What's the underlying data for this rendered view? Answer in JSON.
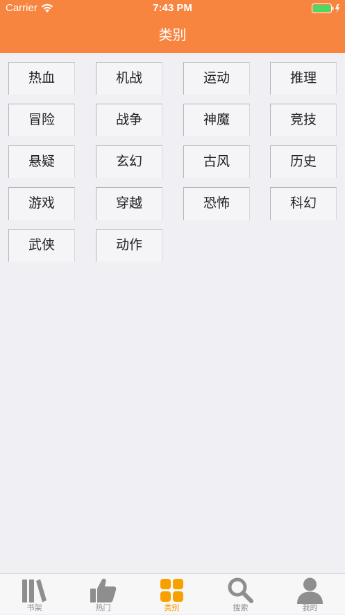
{
  "status_bar": {
    "carrier": "Carrier",
    "time": "7:43 PM"
  },
  "nav": {
    "title": "类别"
  },
  "categories": [
    "热血",
    "机战",
    "运动",
    "推理",
    "冒险",
    "战争",
    "神魔",
    "竞技",
    "悬疑",
    "玄幻",
    "古风",
    "历史",
    "游戏",
    "穿越",
    "恐怖",
    "科幻",
    "武侠",
    "动作"
  ],
  "tabbar": {
    "items": [
      {
        "label": "书架",
        "icon": "bookshelf-icon",
        "active": false
      },
      {
        "label": "热门",
        "icon": "thumbs-up-icon",
        "active": false
      },
      {
        "label": "类别",
        "icon": "category-grid-icon",
        "active": true
      },
      {
        "label": "搜索",
        "icon": "search-icon",
        "active": false
      },
      {
        "label": "我的",
        "icon": "person-icon",
        "active": false
      }
    ]
  },
  "colors": {
    "header": "#F8853F",
    "background": "#EFEFF4",
    "tab_active": "#F8A000",
    "tab_inactive": "#8E8E8E",
    "battery": "#4CD964"
  }
}
